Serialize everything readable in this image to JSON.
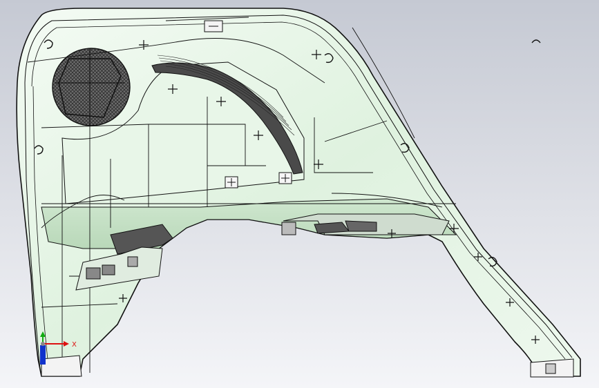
{
  "viewport": {
    "background_top": "#c5c9d3",
    "background_bottom": "#f4f5f8"
  },
  "model": {
    "surface_color": "#e4f4e4",
    "edge_color": "#111111",
    "recess_color": "#4a4a4a",
    "speaker_grille": "speaker-grille-mesh"
  },
  "triad": {
    "x_label": "X",
    "x_color": "#dd1111",
    "y_color": "#11aa11",
    "z_color": "#1133cc"
  }
}
